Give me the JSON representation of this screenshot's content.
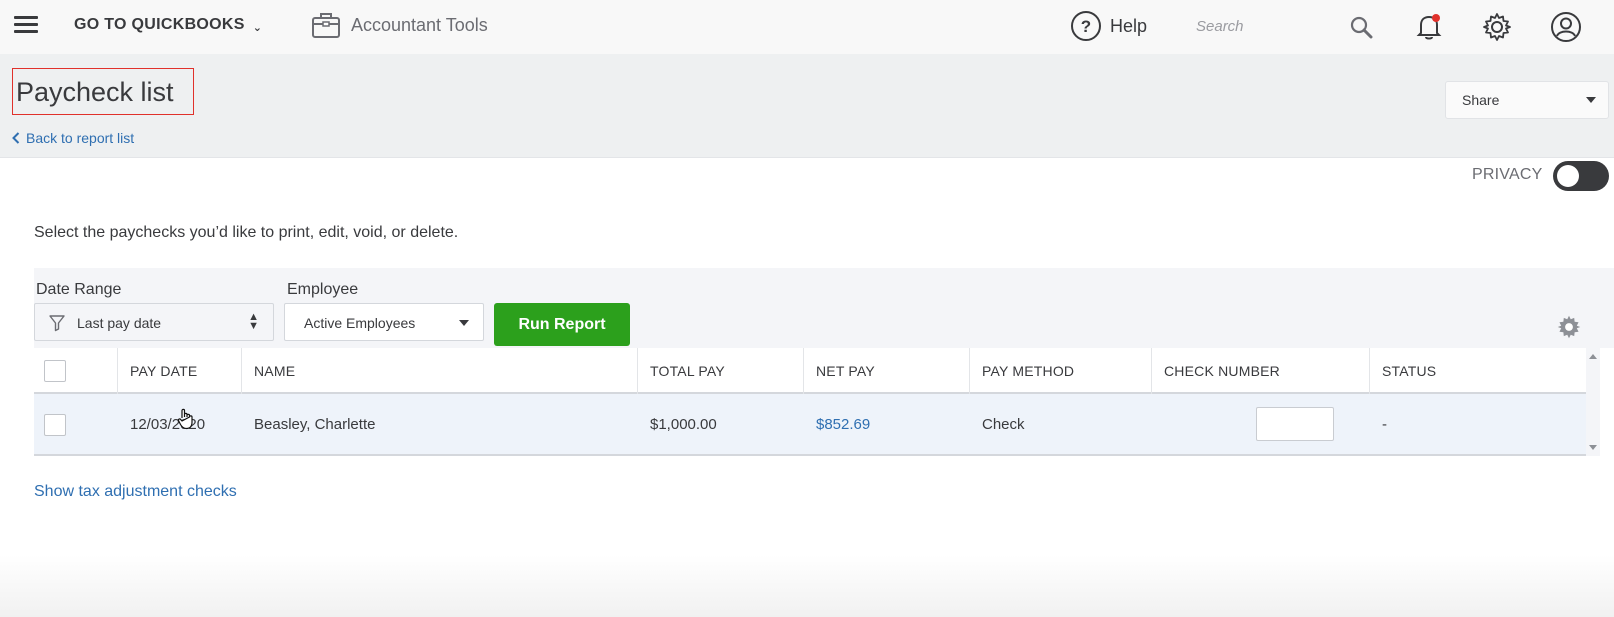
{
  "topbar": {
    "goto_label": "GO TO QUICKBOOKS",
    "accountant_tools_label": "Accountant Tools",
    "help_label": "Help",
    "search_placeholder": "Search",
    "notification_dot_color": "#e0312b"
  },
  "header": {
    "title": "Paycheck list",
    "back_link": "Back to report list",
    "share_label": "Share",
    "title_highlight_color": "#e0312b"
  },
  "privacy": {
    "label": "PRIVACY",
    "enabled": false
  },
  "intro_text": "Select the paychecks you’d like to print, edit, void, or delete.",
  "filters": {
    "date_range_label": "Date Range",
    "date_range_value": "Last pay date",
    "employee_label": "Employee",
    "employee_value": "Active Employees",
    "run_report_label": "Run Report",
    "run_report_color": "#2ca01c"
  },
  "table": {
    "columns": [
      "PAY DATE",
      "NAME",
      "TOTAL PAY",
      "NET PAY",
      "PAY METHOD",
      "CHECK NUMBER",
      "STATUS"
    ],
    "rows": [
      {
        "pay_date": "12/03/2020",
        "name": "Beasley, Charlette",
        "total_pay": "$1,000.00",
        "net_pay": "$852.69",
        "pay_method": "Check",
        "check_number": "",
        "status": "-"
      }
    ]
  },
  "tax_adjustment_link": "Show tax adjustment checks",
  "link_color": "#2f6fb1"
}
